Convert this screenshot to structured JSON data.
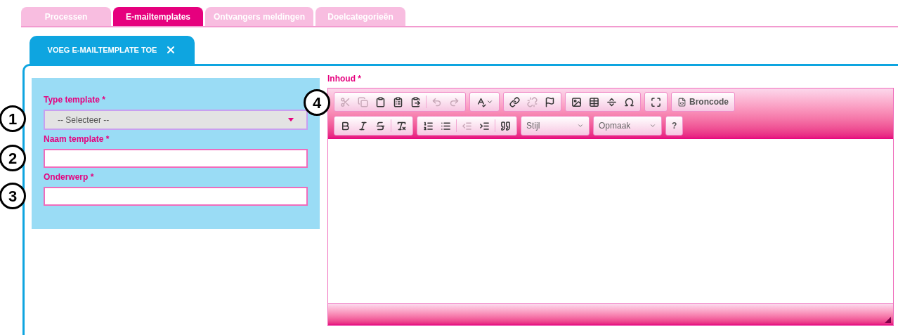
{
  "top_tabs": [
    {
      "label": "Processen",
      "selected": false
    },
    {
      "label": "E-mailtemplates",
      "selected": true
    },
    {
      "label": "Ontvangers meldingen",
      "selected": false
    },
    {
      "label": "Doelcategorieën",
      "selected": false
    }
  ],
  "sub_tab": {
    "label": "VOEG E-MAILTEMPLATE TOE",
    "closable": true
  },
  "form": {
    "fields": [
      {
        "kind": "select",
        "label": "Type template *",
        "value": "-- Selecteer --",
        "marker": "1"
      },
      {
        "kind": "text",
        "label": "Naam template *",
        "marker": "2"
      },
      {
        "kind": "text",
        "label": "Onderwerp *",
        "marker": "3"
      }
    ]
  },
  "editor": {
    "label": "Inhoud *",
    "marker": "4",
    "toolbar_rows": [
      [
        [
          {
            "kind": "icon",
            "disabled": true
          },
          {
            "kind": "icon",
            "disabled": true
          },
          {
            "kind": "icon",
            "disabled": false
          },
          {
            "kind": "icon",
            "disabled": false
          },
          {
            "kind": "icon",
            "disabled": false
          },
          {
            "kind": "separator"
          },
          {
            "kind": "icon",
            "disabled": true
          },
          {
            "kind": "icon",
            "disabled": true
          }
        ],
        [
          {
            "kind": "menu_icon",
            "disabled": false
          }
        ],
        [
          {
            "kind": "icon",
            "disabled": false
          },
          {
            "kind": "icon",
            "disabled": true
          },
          {
            "kind": "icon",
            "disabled": false
          }
        ],
        [
          {
            "kind": "icon",
            "disabled": false
          },
          {
            "kind": "icon",
            "disabled": false
          },
          {
            "kind": "icon",
            "disabled": false
          },
          {
            "kind": "icon",
            "disabled": false
          }
        ],
        [
          {
            "kind": "icon",
            "disabled": false
          }
        ],
        [
          {
            "kind": "text_button",
            "label": "Broncode"
          }
        ]
      ],
      [
        [
          {
            "kind": "icon",
            "disabled": false
          },
          {
            "kind": "icon",
            "disabled": false
          },
          {
            "kind": "icon",
            "disabled": false
          },
          {
            "kind": "separator"
          },
          {
            "kind": "icon",
            "disabled": false
          }
        ],
        [
          {
            "kind": "icon",
            "disabled": false
          },
          {
            "kind": "icon",
            "disabled": false
          },
          {
            "kind": "separator"
          },
          {
            "kind": "icon",
            "disabled": true
          },
          {
            "kind": "icon",
            "disabled": false
          },
          {
            "kind": "separator"
          },
          {
            "kind": "icon",
            "disabled": false
          }
        ],
        [
          {
            "kind": "combo",
            "label": "Stijl"
          }
        ],
        [
          {
            "kind": "combo",
            "label": "Opmaak"
          }
        ],
        [
          {
            "kind": "text_button",
            "label": "?"
          }
        ]
      ]
    ]
  }
}
